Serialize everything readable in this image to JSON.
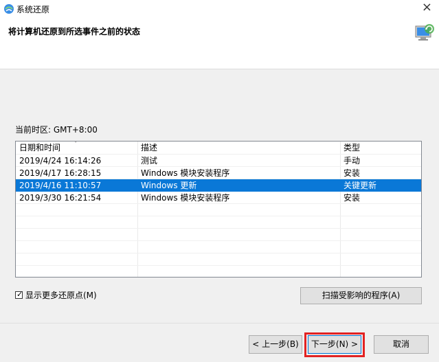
{
  "window": {
    "title": "系统还原",
    "close_glyph": "×",
    "subtitle": "将计算机还原到所选事件之前的状态"
  },
  "timezone_label": "当前时区: GMT+8:00",
  "table": {
    "columns": [
      "日期和时间",
      "描述",
      "类型"
    ],
    "sort_glyph": "ˇ",
    "rows": [
      {
        "date": "2019/4/24 16:14:26",
        "desc": "测试",
        "type": "手动",
        "selected": false
      },
      {
        "date": "2019/4/17 16:28:15",
        "desc": "Windows 模块安装程序",
        "type": "安装",
        "selected": false
      },
      {
        "date": "2019/4/16 11:10:57",
        "desc": "Windows 更新",
        "type": "关键更新",
        "selected": true
      },
      {
        "date": "2019/3/30 16:21:54",
        "desc": "Windows 模块安装程序",
        "type": "安装",
        "selected": false
      }
    ]
  },
  "show_more": {
    "label": "显示更多还原点(M)",
    "checked": true,
    "tick": "✓"
  },
  "buttons": {
    "scan": "扫描受影响的程序(A)",
    "prev": "< 上一步(B)",
    "next": "下一步(N) >",
    "cancel": "取消"
  },
  "colors": {
    "selection": "#0a78d7",
    "highlight_box": "#e22222"
  }
}
